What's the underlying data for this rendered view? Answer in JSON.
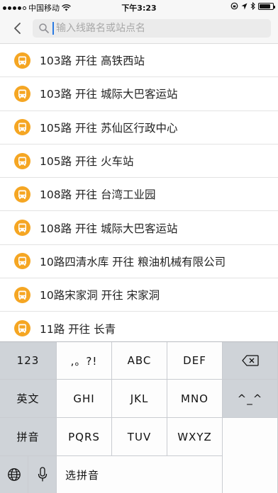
{
  "status_bar": {
    "carrier": "中国移动",
    "time": "下午3:23",
    "signal_filled": 4,
    "signal_total": 5,
    "battery_level": 0.85
  },
  "nav": {
    "back_icon": "chevron-left-icon",
    "search_icon": "search-icon",
    "search_placeholder": "输入线路名或站点名",
    "search_value": ""
  },
  "routes": [
    {
      "label": "103路 开往 高铁西站"
    },
    {
      "label": "103路 开往 城际大巴客运站"
    },
    {
      "label": "105路 开往 苏仙区行政中心"
    },
    {
      "label": "105路 开往 火车站"
    },
    {
      "label": "108路 开往 台湾工业园"
    },
    {
      "label": "108路 开往 城际大巴客运站"
    },
    {
      "label": "10路四清水库 开往 粮油机械有限公司"
    },
    {
      "label": "10路宋家洞 开往 宋家洞"
    },
    {
      "label": "11路 开往 长青"
    }
  ],
  "route_icon": "bus-icon",
  "colors": {
    "accent": "#f5a623",
    "cursor": "#2a7ae2"
  },
  "keyboard": {
    "k_123": "123",
    "k_punct": ",。?!",
    "k_abc": "ABC",
    "k_def": "DEF",
    "k_english": "英文",
    "k_ghi": "GHI",
    "k_jkl": "JKL",
    "k_mno": "MNO",
    "k_emoticon": "^_^",
    "k_pinyin": "拼音",
    "k_pqrs": "PQRS",
    "k_tuv": "TUV",
    "k_wxyz": "WXYZ",
    "k_select_pinyin": "选拼音",
    "icons": {
      "delete": "backspace-icon",
      "globe": "globe-icon",
      "mic": "microphone-icon"
    }
  }
}
